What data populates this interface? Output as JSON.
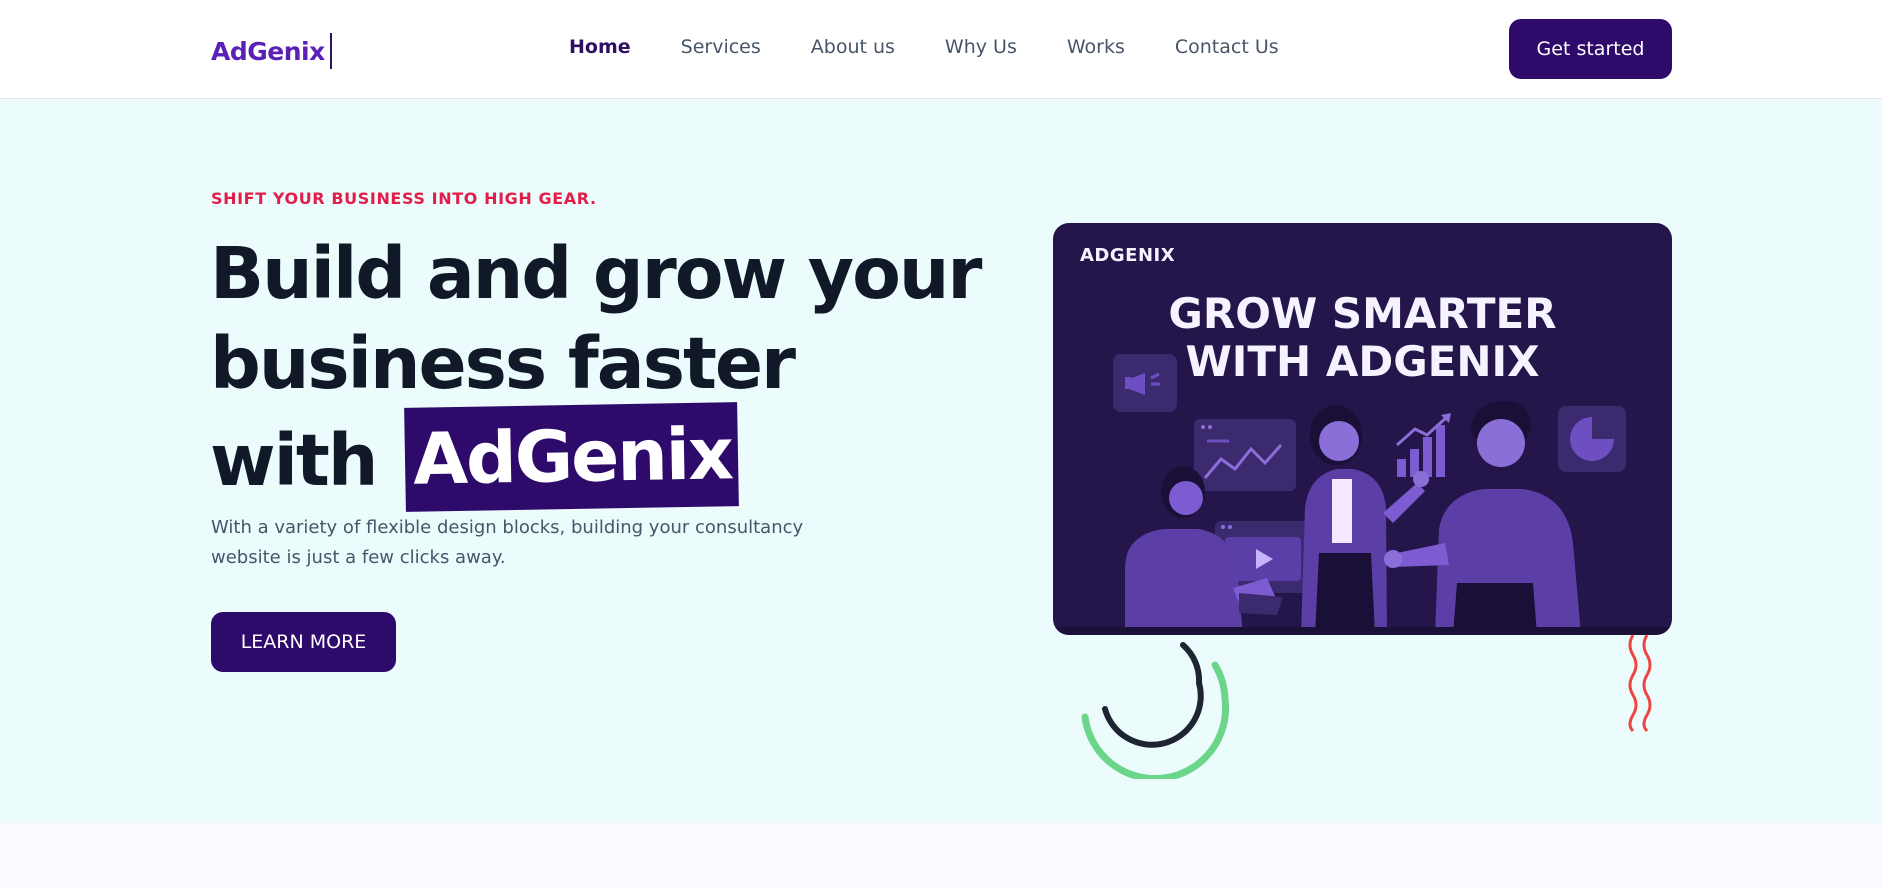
{
  "nav": {
    "logo": "AdGenix",
    "links": [
      "Home",
      "Services",
      "About us",
      "Why Us",
      "Works",
      "Contact Us"
    ],
    "active": "Home",
    "cta": "Get started"
  },
  "hero": {
    "kicker": "SHIFT YOUR BUSINESS INTO HIGH GEAR.",
    "headline_line1": "Build and grow your",
    "headline_line2": "business faster",
    "headline_line3_prefix": "with",
    "headline_highlight": "AdGenix",
    "description": "With a variety of flexible design blocks, building your consultancy website is just a few clicks away.",
    "button": "LEARN MORE"
  },
  "card": {
    "brand": "ADGENIX",
    "title_line1": "GROW SMARTER",
    "title_line2": "WITH ADGENIX"
  },
  "colors": {
    "primary": "#2e0b6b",
    "accent": "#e11d48",
    "hero_bg": "#ecfcfd",
    "card_bg": "#24164a"
  },
  "icons": [
    "megaphone-icon",
    "line-chart-icon",
    "bar-chart-icon",
    "pie-chart-icon",
    "video-play-icon"
  ]
}
